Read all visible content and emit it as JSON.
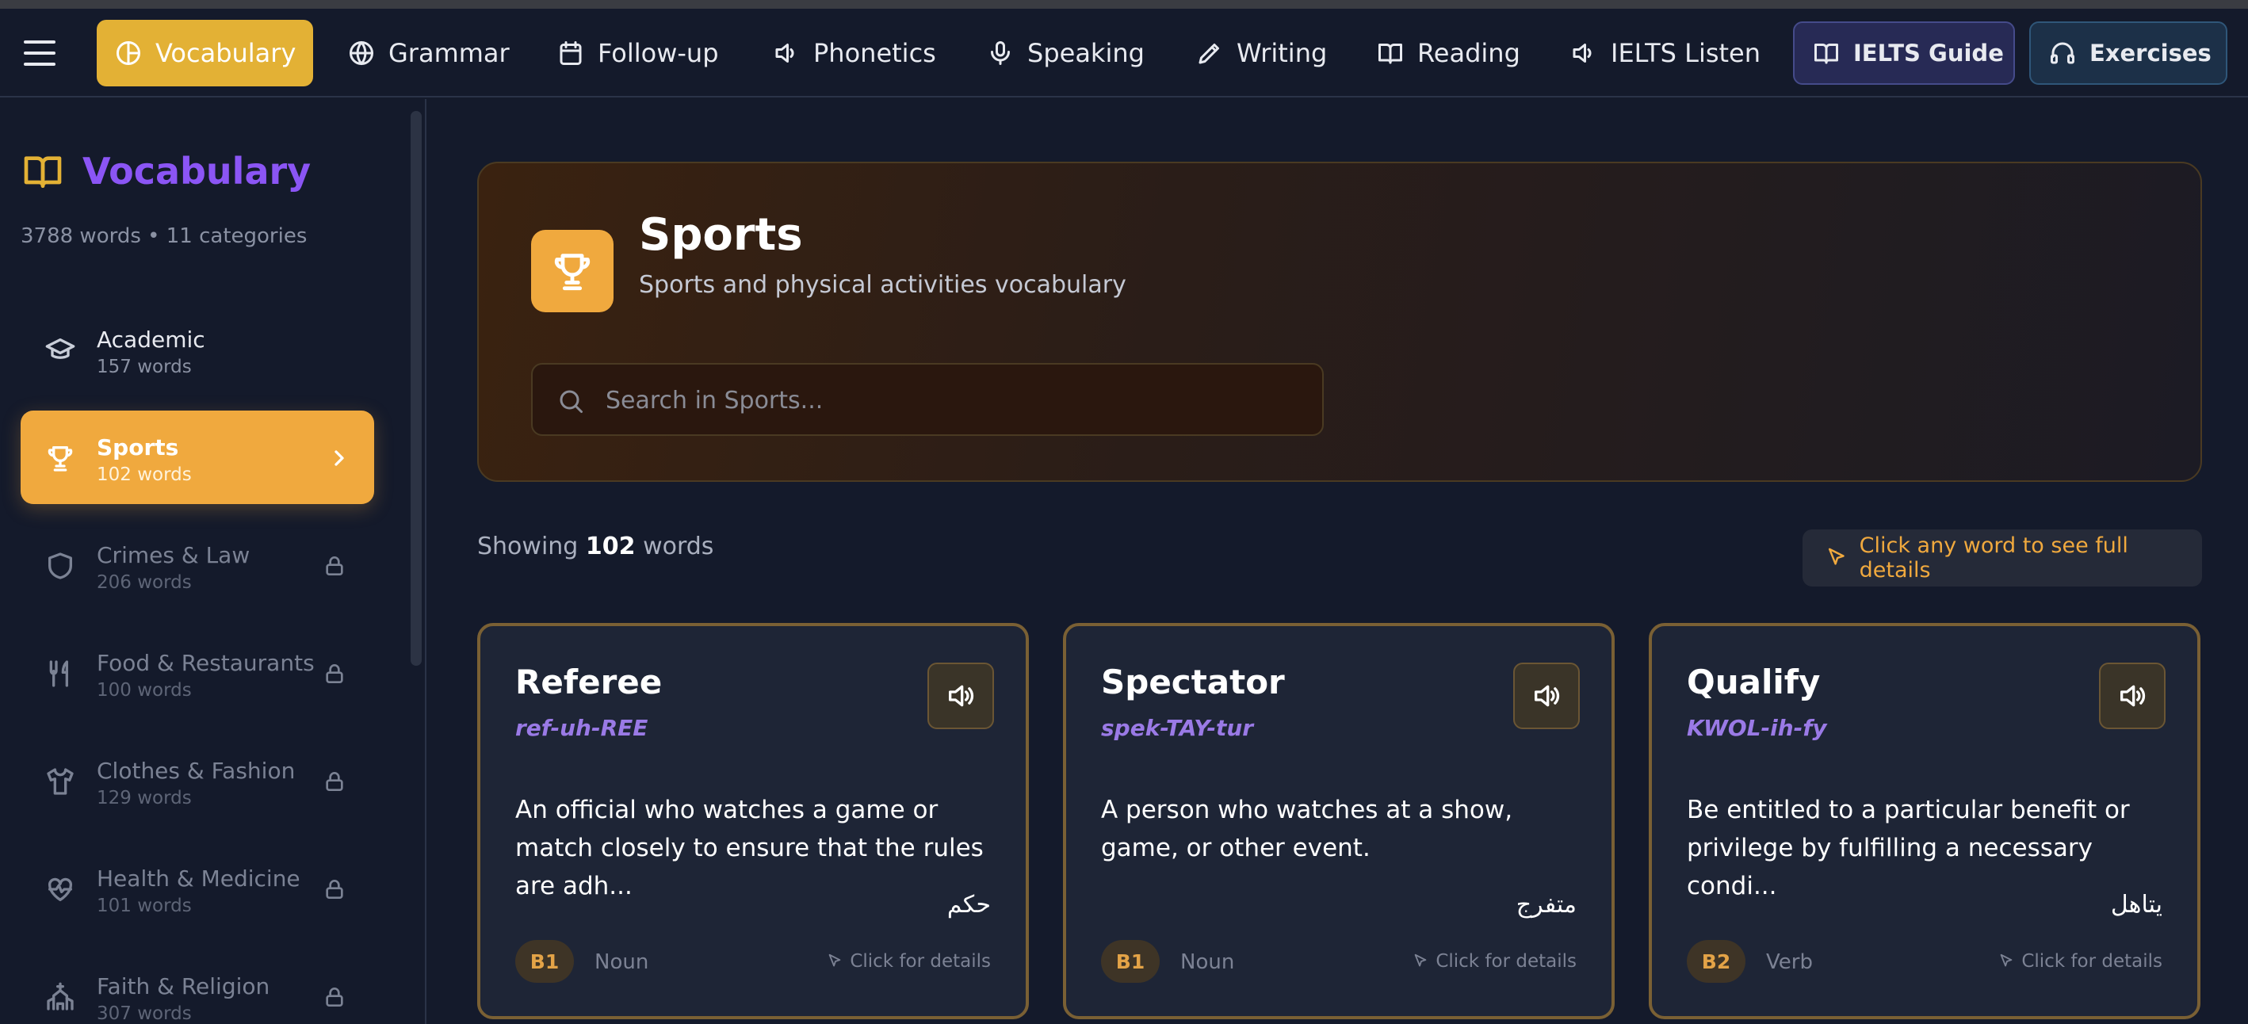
{
  "nav": {
    "items": [
      {
        "label": "Vocabulary",
        "icon": "pie-icon"
      },
      {
        "label": "Grammar",
        "icon": "globe-icon"
      },
      {
        "label": "Follow-up",
        "icon": "calendar-icon"
      },
      {
        "label": "Phonetics",
        "icon": "speaker-icon"
      },
      {
        "label": "Speaking",
        "icon": "mic-icon"
      },
      {
        "label": "Writing",
        "icon": "pen-icon"
      },
      {
        "label": "Reading",
        "icon": "book-icon"
      },
      {
        "label": "IELTS Listen",
        "icon": "speaker-icon"
      }
    ],
    "guide_label": "IELTS Guide",
    "exercises_label": "Exercises"
  },
  "sidebar": {
    "title": "Vocabulary",
    "subtitle": "3788 words • 11 categories",
    "categories": [
      {
        "name": "Academic",
        "count": "157 words",
        "icon": "graduation-cap-icon"
      },
      {
        "name": "Sports",
        "count": "102 words",
        "icon": "trophy-icon"
      },
      {
        "name": "Crimes & Law",
        "count": "206 words",
        "icon": "shield-icon"
      },
      {
        "name": "Food & Restaurants",
        "count": "100 words",
        "icon": "utensils-icon"
      },
      {
        "name": "Clothes & Fashion",
        "count": "129 words",
        "icon": "shirt-icon"
      },
      {
        "name": "Health & Medicine",
        "count": "101 words",
        "icon": "heart-pulse-icon"
      },
      {
        "name": "Faith & Religion",
        "count": "307 words",
        "icon": "church-icon"
      }
    ]
  },
  "hero": {
    "title": "Sports",
    "subtitle": "Sports and physical activities vocabulary",
    "search_placeholder": "Search in Sports..."
  },
  "results": {
    "prefix": "Showing",
    "count": "102",
    "suffix": "words",
    "hint": "Click any word to see full details"
  },
  "cards": [
    {
      "word": "Referee",
      "pron": "ref-uh-REE",
      "definition": "An official who watches a game or match closely to ensure that the rules are adh...",
      "arabic": "حكم",
      "level": "B1",
      "pos": "Noun",
      "details": "Click for details"
    },
    {
      "word": "Spectator",
      "pron": "spek-TAY-tur",
      "definition": "A person who watches at a show, game, or other event.",
      "arabic": "متفرج",
      "level": "B1",
      "pos": "Noun",
      "details": "Click for details"
    },
    {
      "word": "Qualify",
      "pron": "KWOL-ih-fy",
      "definition": "Be entitled to a particular benefit or privilege by fulfilling a necessary condi...",
      "arabic": "يتاهل",
      "level": "B2",
      "pos": "Verb",
      "details": "Click for details"
    }
  ],
  "colors": {
    "accent": "#e3b135",
    "active_category": "#f0a93e",
    "brand_purple": "#8b55f5",
    "background": "#141a2b"
  }
}
